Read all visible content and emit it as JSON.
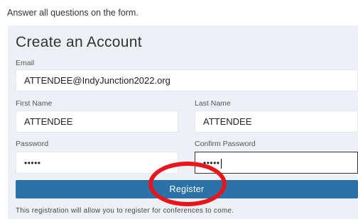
{
  "instructions": "Answer all questions on the form.",
  "form": {
    "title": "Create an Account",
    "email_label": "Email",
    "email_value": "ATTENDEE@IndyJunction2022.org",
    "first_name_label": "First Name",
    "first_name_value": "ATTENDEE",
    "last_name_label": "Last Name",
    "last_name_value": "ATTENDEE",
    "password_label": "Password",
    "password_value": "•••••",
    "confirm_password_label": "Confirm Password",
    "confirm_password_value": "•••••",
    "register_label": "Register",
    "footnote": "This registration will allow you to register for conferences to come."
  },
  "annotation": {
    "color": "#e8151b"
  }
}
